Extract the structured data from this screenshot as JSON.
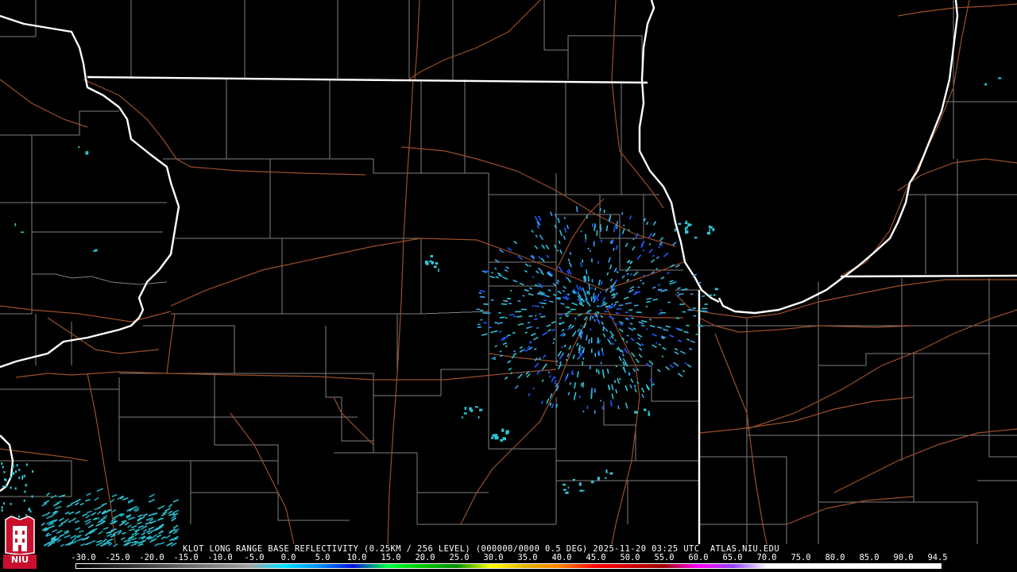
{
  "product": {
    "caption": "KLOT LONG RANGE BASE REFLECTIVITY (0.25KM / 256 LEVEL) (000000/0000 0.5 DEG) 2025-11-20 03:25 UTC  ATLAS.NIU.EDU",
    "radar_site": "KLOT"
  },
  "logo": {
    "text": "NIU",
    "color": "#c8102e"
  },
  "colors": {
    "background": "#000000",
    "state_border": "#ffffff",
    "county_line": "#8c8c8c",
    "road": "#a0522d",
    "echo_light": "#2ec4d6",
    "echo_medium": "#3aa0f0",
    "echo_strong": "#1c5cff"
  },
  "scale": {
    "labels": [
      "-30.0",
      "-25.0",
      "-20.0",
      "-15.0",
      "-10.0",
      "-5.0",
      "0.0",
      "5.0",
      "10.0",
      "15.0",
      "20.0",
      "25.0",
      "30.0",
      "35.0",
      "40.0",
      "45.0",
      "50.0",
      "55.0",
      "60.0",
      "65.0",
      "70.0",
      "75.0",
      "80.0",
      "85.0",
      "90.0",
      "94.5"
    ],
    "gradient_stops": [
      "#000000",
      "#202020",
      "#404040",
      "#606060",
      "#808080",
      "#a0a0a0",
      "#00e0ff",
      "#0090ff",
      "#0010e0",
      "#00ff40",
      "#00c800",
      "#009000",
      "#ffff00",
      "#e0b000",
      "#ff8000",
      "#ff0000",
      "#d00000",
      "#a00000",
      "#ff00ff",
      "#9040ff",
      "#ffffff",
      "#ffffff",
      "#ffffff",
      "#ffffff",
      "#ffffff",
      "#ffffff"
    ]
  }
}
